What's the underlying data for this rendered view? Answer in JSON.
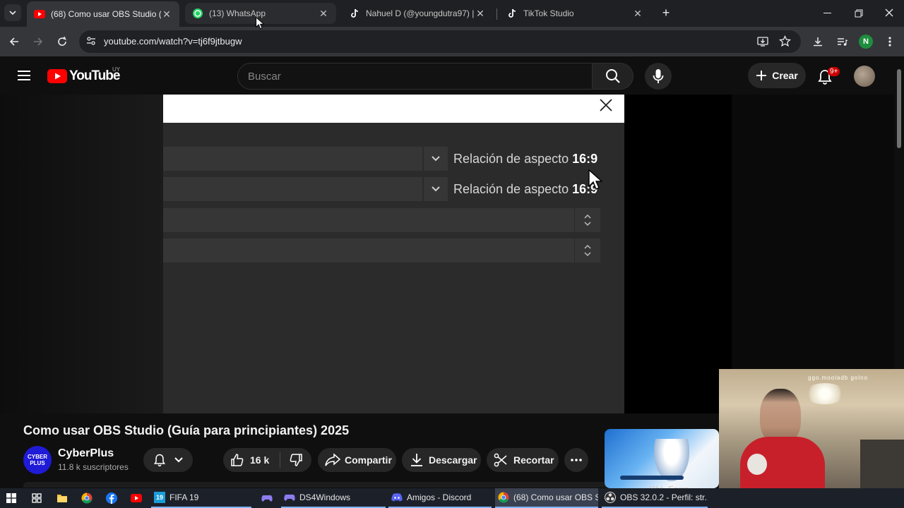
{
  "browser": {
    "tabs": [
      {
        "title": "(68) Como usar OBS Studio (Gu",
        "icon": "youtube-icon",
        "active": true
      },
      {
        "title": "(13) WhatsApp",
        "icon": "whatsapp-icon",
        "active": false
      },
      {
        "title": "Nahuel D (@youngdutra97) | Ti",
        "icon": "tiktok-icon",
        "active": false
      },
      {
        "title": "TikTok Studio",
        "icon": "tiktok-icon",
        "active": false
      }
    ],
    "url": "youtube.com/watch?v=tj6f9jtbugw",
    "profile_initial": "N",
    "colors": {
      "tabstrip": "#1f2023",
      "toolbar": "#35363a",
      "omnibox": "#202124",
      "profile": "#1e8e3e"
    }
  },
  "youtube": {
    "logo_text": "YouTube",
    "country_code": "UY",
    "search_placeholder": "Buscar",
    "create_label": "Crear",
    "notifications_badge": "9+",
    "colors": {
      "brand_red": "#ff0000",
      "badge": "#cc0000",
      "background": "#0f0f0f"
    }
  },
  "video_frame": {
    "rows": [
      {
        "label": "Relación de aspecto",
        "value": "16:9",
        "control": "dropdown"
      },
      {
        "label": "Relación de aspecto",
        "value": "16:9",
        "control": "dropdown"
      },
      {
        "label": "",
        "value": "",
        "control": "spinner"
      },
      {
        "label": "",
        "value": "",
        "control": "spinner"
      }
    ]
  },
  "video": {
    "title": "Como usar OBS Studio (Guía para principiantes) 2025",
    "channel": {
      "name": "CyberPlus",
      "subscribers": "11.8 k suscriptores",
      "avatar_text_1": "CYBER",
      "avatar_text_2": "PLUS"
    },
    "actions": {
      "likes": "16 k",
      "share": "Compartir",
      "download": "Descargar",
      "clip": "Recortar"
    },
    "recommendation_partial_text": "ObL Form..."
  },
  "webcam": {
    "overlay_text": "ggo.mooladb golno"
  },
  "taskbar": {
    "items": [
      {
        "label": "",
        "icon": "windows-start-icon"
      },
      {
        "label": "",
        "icon": "task-view-icon"
      },
      {
        "label": "",
        "icon": "file-explorer-icon"
      },
      {
        "label": "",
        "icon": "chrome-icon"
      },
      {
        "label": "",
        "icon": "facebook-icon"
      },
      {
        "label": "",
        "icon": "youtube-icon"
      },
      {
        "label": "FIFA 19",
        "icon": "fifa-icon"
      },
      {
        "label": "",
        "icon": "gamepad-icon"
      },
      {
        "label": "DS4Windows",
        "icon": "gamepad-icon"
      },
      {
        "label": "Amigos - Discord",
        "icon": "discord-icon"
      },
      {
        "label": "(68) Como usar OBS S...",
        "icon": "chrome-icon"
      },
      {
        "label": "OBS 32.0.2 - Perfil: str...",
        "icon": "obs-icon"
      }
    ]
  }
}
